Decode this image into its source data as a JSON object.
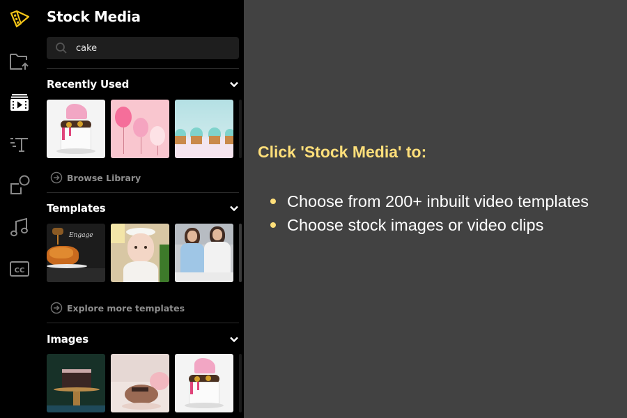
{
  "rail": {
    "items": [
      {
        "name": "logo",
        "icon": "film-cone-logo-icon",
        "color": "#f5c518"
      },
      {
        "name": "upload",
        "icon": "folder-upload-icon"
      },
      {
        "name": "stock-media",
        "icon": "stock-media-icon",
        "active": true
      },
      {
        "name": "text",
        "icon": "text-icon"
      },
      {
        "name": "elements",
        "icon": "shapes-icon"
      },
      {
        "name": "music",
        "icon": "music-note-icon"
      },
      {
        "name": "captions",
        "icon": "closed-captions-icon",
        "label": "CC"
      }
    ]
  },
  "panel": {
    "title": "Stock Media",
    "search": {
      "value": "cake",
      "placeholder": "Search"
    },
    "sections": [
      {
        "title": "Recently Used",
        "thumbs": [
          "Drip cake with chocolates",
          "Pink balloons",
          "Mint cupcakes"
        ],
        "link": "Browse Library"
      },
      {
        "title": "Templates",
        "thumbs": [
          "Croissant honey template",
          "Baby portrait template",
          "Mother and daughter template"
        ],
        "link": "Explore more templates"
      },
      {
        "title": "Images",
        "thumbs": [
          "Chocolate cake on stand",
          "Chocolate cake pink flowers",
          "Drip cake with chocolates"
        ]
      }
    ]
  },
  "callout": {
    "title": "Click 'Stock Media' to:",
    "bullets": [
      "Choose from 200+ inbuilt video templates",
      "Choose stock images or video clips"
    ],
    "accent": "#ffdf7a"
  }
}
